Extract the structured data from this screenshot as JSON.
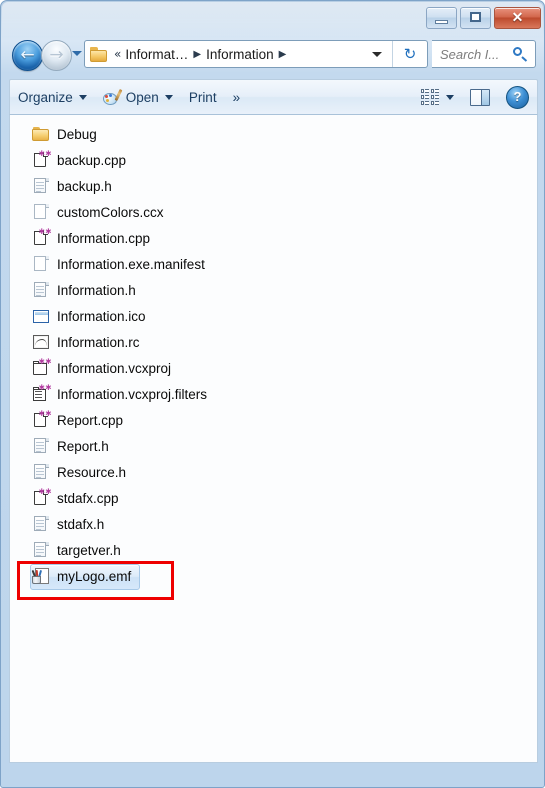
{
  "window": {
    "controls": {
      "minimize_label": "—",
      "maximize_label": "",
      "close_label": "✕"
    }
  },
  "navigation": {
    "back_label": "←",
    "forward_label": "→",
    "recent_dropdown_label": ""
  },
  "address_bar": {
    "overflow_label": "«",
    "crumb1": "Informat…",
    "separator1": "▶",
    "crumb2": "Information",
    "separator2": "▶",
    "refresh_label": "↻"
  },
  "search": {
    "placeholder": "Search I..."
  },
  "toolbar": {
    "organize_label": "Organize",
    "open_label": "Open",
    "print_label": "Print",
    "overflow_label": "»",
    "help_label": "?"
  },
  "file_list": {
    "items": [
      {
        "name": "Debug",
        "type": "folder"
      },
      {
        "name": "backup.cpp",
        "type": "cpp"
      },
      {
        "name": "backup.h",
        "type": "h"
      },
      {
        "name": "customColors.ccx",
        "type": "blank"
      },
      {
        "name": "Information.cpp",
        "type": "cpp"
      },
      {
        "name": "Information.exe.manifest",
        "type": "blank"
      },
      {
        "name": "Information.h",
        "type": "h"
      },
      {
        "name": "Information.ico",
        "type": "icofile"
      },
      {
        "name": "Information.rc",
        "type": "rcfile"
      },
      {
        "name": "Information.vcxproj",
        "type": "proj"
      },
      {
        "name": "Information.vcxproj.filters",
        "type": "filters"
      },
      {
        "name": "Report.cpp",
        "type": "cpp"
      },
      {
        "name": "Report.h",
        "type": "h"
      },
      {
        "name": "Resource.h",
        "type": "h"
      },
      {
        "name": "stdafx.cpp",
        "type": "cpp"
      },
      {
        "name": "stdafx.h",
        "type": "h"
      },
      {
        "name": "targetver.h",
        "type": "h"
      },
      {
        "name": "myLogo.emf",
        "type": "emf",
        "selected": true
      }
    ]
  },
  "annotation": {
    "highlight_color": "#ee0000"
  }
}
